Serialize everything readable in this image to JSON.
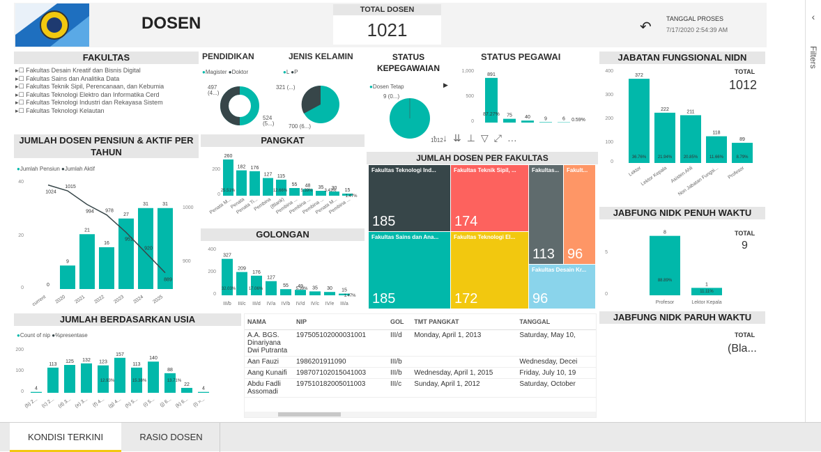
{
  "header": {
    "title": "DOSEN",
    "total_label": "TOTAL DOSEN",
    "total_value": "1021",
    "tanggal_label": "TANGGAL PROSES",
    "tanggal_value": "7/17/2020 2:54:39 AM",
    "back_icon": "undo-arrow-icon"
  },
  "fakultas": {
    "title": "FAKULTAS",
    "items": [
      "Fakultas Desain Kreatif dan Bisnis Digital",
      "Fakultas Sains dan Analitika Data",
      "Fakultas Teknik Sipil, Perencanaan, dan Kebumia",
      "Fakultas Teknologi Elektro dan Informatika Cerd",
      "Fakultas Teknologi Industri dan Rekayasa Sistem",
      "Fakultas Teknologi Kelautan"
    ]
  },
  "pendidikan": {
    "title": "PENDIDIKAN",
    "legend": [
      "Magister",
      "Doktor"
    ],
    "label_a": "497",
    "label_a2": "(4...)",
    "label_b": "524",
    "label_b2": "(5...)"
  },
  "jenis_kelamin": {
    "title": "JENIS KELAMIN",
    "legend": [
      "L",
      "P"
    ],
    "label_a": "321 (...)",
    "label_b": "700 (6...)"
  },
  "status_kepegawaian": {
    "title": "STATUS KEPEGAWAIAN",
    "legend": [
      "Dosen Tetap"
    ],
    "label_a": "9 (0...)",
    "label_b": "1012"
  },
  "status_pegawai": {
    "title": "STATUS PEGAWAI",
    "ticks": [
      "1,000",
      "500",
      "0"
    ],
    "values": [
      "891",
      "75",
      "40",
      "9",
      "6"
    ],
    "pct": [
      "87.27%",
      "0.59%"
    ]
  },
  "jabatan": {
    "title": "JABATAN FUNGSIONAL NIDN",
    "total_label": "TOTAL",
    "total_value": "1012",
    "ticks": [
      "400",
      "300",
      "200",
      "100",
      "0"
    ],
    "bars": [
      {
        "name": "Lektor",
        "v": "372",
        "p": "36.76%"
      },
      {
        "name": "Lektor Kepala",
        "v": "222",
        "p": "21.94%"
      },
      {
        "name": "Asisten Ahli",
        "v": "211",
        "p": "20.85%"
      },
      {
        "name": "Non Jabatan Fungsi...",
        "v": "118",
        "p": "11.66%"
      },
      {
        "name": "Profesor",
        "v": "89",
        "p": "8.79%"
      }
    ]
  },
  "pensiun": {
    "title": "JUMLAH DOSEN PENSIUN & AKTIF PER TAHUN",
    "legend": [
      "Jumlah Pensiun",
      "Jumlah Aktif"
    ],
    "ticks_left": [
      "40",
      "20",
      "0"
    ],
    "ticks_right": [
      "1000",
      "900"
    ],
    "cats": [
      "current",
      "2020",
      "2021",
      "2022",
      "2023",
      "2024",
      "2025"
    ],
    "pensiun": [
      "0",
      "9",
      "21",
      "16",
      "27",
      "31",
      "31"
    ],
    "aktif": [
      "1024",
      "1015",
      "994",
      "978",
      "951",
      "920",
      "889"
    ]
  },
  "pangkat": {
    "title": "PANGKAT",
    "ticks": [
      "200",
      "0"
    ],
    "values": [
      "260",
      "182",
      "176",
      "127",
      "115",
      "55",
      "48",
      "35",
      "30",
      "15"
    ],
    "pct": [
      "25.51%",
      "12.66%",
      "5.39%",
      "3.43%",
      "1.47%"
    ],
    "cats": [
      "Penata M...",
      "Penata",
      "Penata Ti...",
      "Pembina",
      "(Blank)",
      "Pembina ...",
      "Pembina ...",
      "Pembina ...",
      "Penata M...",
      "Pembina ..."
    ]
  },
  "golongan": {
    "title": "GOLONGAN",
    "ticks": [
      "400",
      "200",
      "0"
    ],
    "values": [
      "327",
      "209",
      "176",
      "127",
      "55",
      "49",
      "35",
      "30",
      "15"
    ],
    "pct": [
      "32.03%",
      "17.06%",
      "5.39%",
      "1.47%"
    ],
    "cats": [
      "III/b",
      "III/c",
      "III/d",
      "IV/a",
      "IV/b",
      "IV/d",
      "IV/c",
      "IV/e",
      "III/a"
    ]
  },
  "per_fakultas": {
    "title": "JUMLAH DOSEN PER FAKULTAS",
    "tiles": [
      {
        "name": "Fakultas Teknologi Ind...",
        "v": "185",
        "color": "#374649"
      },
      {
        "name": "Fakultas Teknik Sipil, ...",
        "v": "174",
        "color": "#fd625e"
      },
      {
        "name": "Fakultas...",
        "v": "113",
        "color": "#5f6b6d"
      },
      {
        "name": "Fakult...",
        "v": "96",
        "color": "#fe9666"
      },
      {
        "name": "Fakultas Sains dan Ana...",
        "v": "185",
        "color": "#01b8aa"
      },
      {
        "name": "Fakultas Teknologi El...",
        "v": "172",
        "color": "#f2c80f"
      },
      {
        "name": "Fakultas Desain Kr...",
        "v": "96",
        "color": "#8ad4eb"
      }
    ]
  },
  "jabfung_penuh": {
    "title": "JABFUNG NIDK PENUH WAKTU",
    "total_label": "TOTAL",
    "total_value": "9",
    "ticks": [
      "5",
      "0"
    ],
    "bars": [
      {
        "name": "Profesor",
        "v": "8",
        "p": "88.89%"
      },
      {
        "name": "Lektor Kepala",
        "v": "1",
        "p": "11.11%"
      }
    ]
  },
  "jabfung_paruh": {
    "title": "JABFUNG NIDK PARUH WAKTU",
    "total_label": "TOTAL",
    "total_value": "(Bla..."
  },
  "usia": {
    "title": "JUMLAH BERDASARKAN USIA",
    "legend": [
      "Count of nip",
      "%presentase"
    ],
    "ticks": [
      "200",
      "100",
      "0"
    ],
    "values": [
      "4",
      "113",
      "125",
      "132",
      "123",
      "157",
      "113",
      "140",
      "88",
      "22",
      "4"
    ],
    "pct": [
      "12.93%",
      "15.38%",
      "13.71%"
    ],
    "cats": [
      "(b) 2...",
      "(c) 2...",
      "(d) 3...",
      "(e) 3...",
      "(f) 4...",
      "(g) 4...",
      "(h) 5...",
      "(i) 5...",
      "(j) 6...",
      "(k) 6...",
      "(l) >..."
    ]
  },
  "table": {
    "headers": [
      "NAMA",
      "NIP",
      "GOL",
      "TMT PANGKAT",
      "TANGGAL"
    ],
    "rows": [
      [
        "A.A. BGS. Dinariyana Dwi Putranta",
        "197505102000031001",
        "III/d",
        "Monday, April 1, 2013",
        "Saturday, May 10,"
      ],
      [
        "Aan Fauzi",
        "19862019110​90",
        "III/b",
        "",
        "Wednesday, Decei"
      ],
      [
        "Aang Kunaifi",
        "198707102015041003",
        "III/b",
        "Wednesday, April 1, 2015",
        "Friday, July 10, 19"
      ],
      [
        "Abdu Fadli Assomadi",
        "197510182005011003",
        "III/c",
        "Sunday, April 1, 2012",
        "Saturday, October"
      ]
    ]
  },
  "tabs": [
    "KONDISI TERKINI",
    "RASIO DOSEN"
  ],
  "filters_label": "Filters",
  "colors": {
    "teal": "#01b8aa",
    "dark": "#374649"
  }
}
